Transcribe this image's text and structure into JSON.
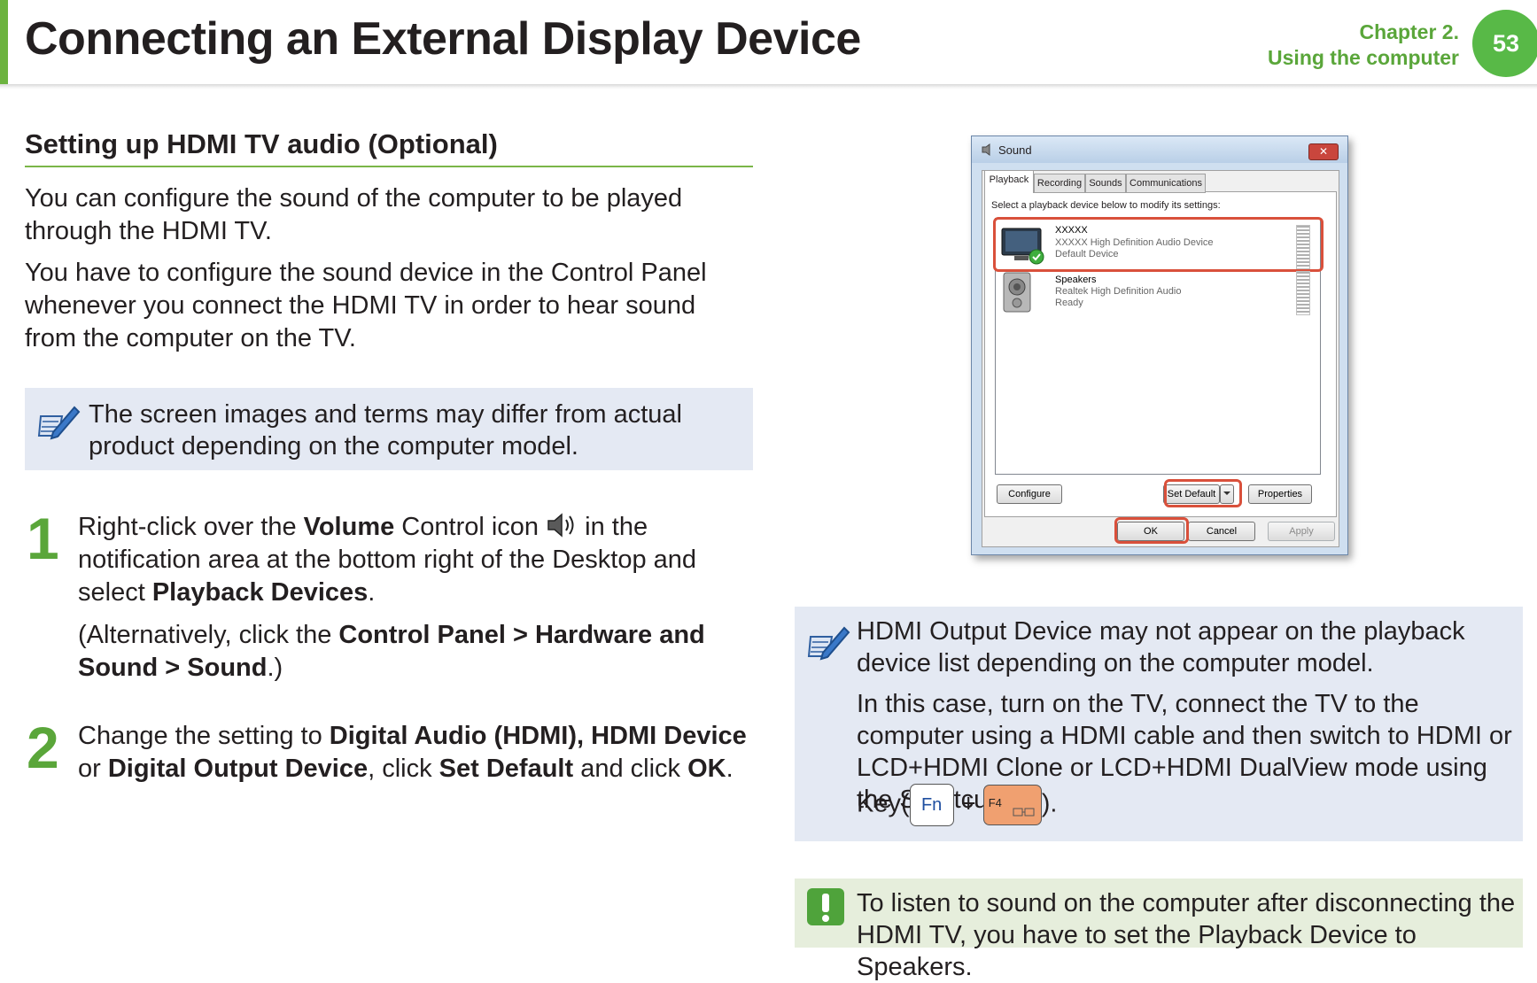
{
  "header": {
    "title": "Connecting an External Display Device",
    "chapter": "Chapter 2.",
    "chapter_subtitle": "Using the computer",
    "page_number": "53"
  },
  "section": {
    "heading": "Setting up HDMI TV audio (Optional)",
    "intro_1": "You can configure the sound of the computer to be played through the HDMI TV.",
    "intro_2": "You have to configure the sound device in the Control Panel whenever you connect the HDMI TV in order to hear sound from the computer on the TV."
  },
  "note_1": {
    "text": "The screen images and terms may differ from actual product depending on the computer model."
  },
  "steps": [
    {
      "number": "1",
      "text_a": "Right-click over the ",
      "bold_a": "Volume",
      "text_b": " Control icon ",
      "text_c": " in the notification area at the bottom right of the Desktop and select ",
      "bold_b": "Playback Devices",
      "text_d": ".",
      "alt_a": "(Alternatively, click the ",
      "alt_bold_a": "Control Panel",
      "alt_sep_1": " > ",
      "alt_bold_b": "Hardware and Sound",
      "alt_sep_2": " > ",
      "alt_bold_c": "Sound",
      "alt_end": ".)"
    },
    {
      "number": "2",
      "text_a": "Change the setting to ",
      "bold_a": "Digital Audio (HDMI), HDMI Device",
      "text_b": " or ",
      "bold_b": "Digital Output Device",
      "text_c": ", click ",
      "bold_c": "Set Default",
      "text_d": " and click ",
      "bold_d": "OK",
      "text_e": "."
    }
  ],
  "dialog": {
    "title": "Sound",
    "close": "✕",
    "tabs": [
      "Playback",
      "Recording",
      "Sounds",
      "Communications"
    ],
    "instruction": "Select a playback device below to modify its settings:",
    "devices": [
      {
        "name": "XXXXX",
        "description": "XXXXX High Definition Audio Device",
        "status": "Default Device"
      },
      {
        "name": "Speakers",
        "description": "Realtek High Definition Audio",
        "status": "Ready"
      }
    ],
    "buttons": {
      "configure": "Configure",
      "set_default": "Set Default",
      "properties": "Properties",
      "ok": "OK",
      "cancel": "Cancel",
      "apply": "Apply"
    }
  },
  "note_2": {
    "line_1": "HDMI Output Device may not appear on the playback device list depending on the computer model.",
    "line_2": "In this case, turn on the TV, connect the TV to the computer using a HDMI cable and then switch to HDMI or LCD+HDMI Clone or LCD+HDMI DualView mode using the Shortcut",
    "key_prefix": "Key(",
    "key_fn": "Fn",
    "plus": "+",
    "key_f4": "F4",
    "key_suffix": ")."
  },
  "note_3": {
    "text": "To listen to sound on the computer after disconnecting the HDMI TV, you have to set the Playback Device to Speakers."
  },
  "colors": {
    "accent_green": "#5aa63a",
    "note_blue_bg": "#e4e9f3",
    "note_green_bg": "#e6eedc",
    "highlight_red": "#d9503b"
  }
}
